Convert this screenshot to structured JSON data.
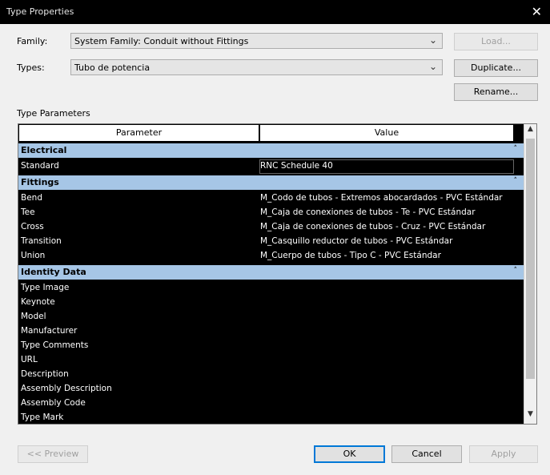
{
  "window": {
    "title": "Type Properties",
    "close_label": "✕"
  },
  "family": {
    "label": "Family:",
    "value": "System Family: Conduit without Fittings",
    "arrow": "⌄"
  },
  "types": {
    "label": "Types:",
    "value": "Tubo de potencia",
    "arrow": "⌄"
  },
  "buttons": {
    "load": "Load...",
    "duplicate": "Duplicate...",
    "rename": "Rename...",
    "preview": "<< Preview",
    "ok": "OK",
    "cancel": "Cancel",
    "apply": "Apply"
  },
  "type_parameters_label": "Type Parameters",
  "grid": {
    "header": {
      "parameter": "Parameter",
      "value": "Value"
    },
    "groups": [
      {
        "name": "Electrical",
        "rows": [
          {
            "param": "Standard",
            "value": "RNC Schedule 40"
          }
        ]
      },
      {
        "name": "Fittings",
        "rows": [
          {
            "param": "Bend",
            "value": "M_Codo de tubos - Extremos abocardados - PVC Estándar"
          },
          {
            "param": "Tee",
            "value": "M_Caja de conexiones de tubos - Te - PVC Estándar"
          },
          {
            "param": "Cross",
            "value": "M_Caja de conexiones de tubos - Cruz - PVC Estándar"
          },
          {
            "param": "Transition",
            "value": "M_Casquillo reductor de tubos - PVC Estándar"
          },
          {
            "param": "Union",
            "value": "M_Cuerpo de tubos - Tipo C - PVC Estándar"
          }
        ]
      },
      {
        "name": "Identity Data",
        "rows": [
          {
            "param": "Type Image",
            "value": ""
          },
          {
            "param": "Keynote",
            "value": ""
          },
          {
            "param": "Model",
            "value": ""
          },
          {
            "param": "Manufacturer",
            "value": ""
          },
          {
            "param": "Type Comments",
            "value": ""
          },
          {
            "param": "URL",
            "value": ""
          },
          {
            "param": "Description",
            "value": ""
          },
          {
            "param": "Assembly Description",
            "value": ""
          },
          {
            "param": "Assembly Code",
            "value": ""
          },
          {
            "param": "Type Mark",
            "value": ""
          }
        ]
      }
    ],
    "collapse_glyph": "˄",
    "scroll_up": "▲",
    "scroll_down": "▼"
  }
}
